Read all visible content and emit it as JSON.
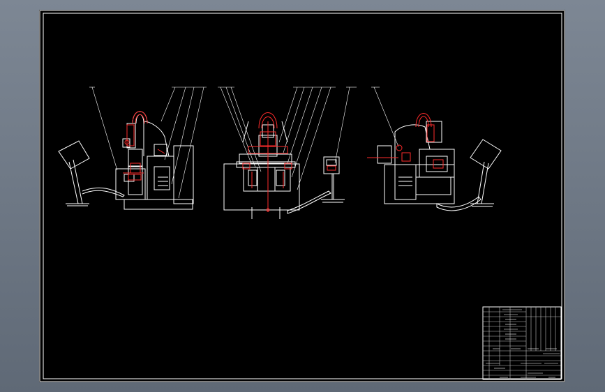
{
  "drawing": {
    "background": "#000000",
    "frame_color": "#ffffff",
    "line_color": "#ffffff",
    "center_line_color": "#ff2b2b",
    "viewport_color": "#6b7581",
    "views": [
      "left-side-view",
      "front-view",
      "right-side-view"
    ],
    "title_block": {
      "rows_text": []
    }
  }
}
